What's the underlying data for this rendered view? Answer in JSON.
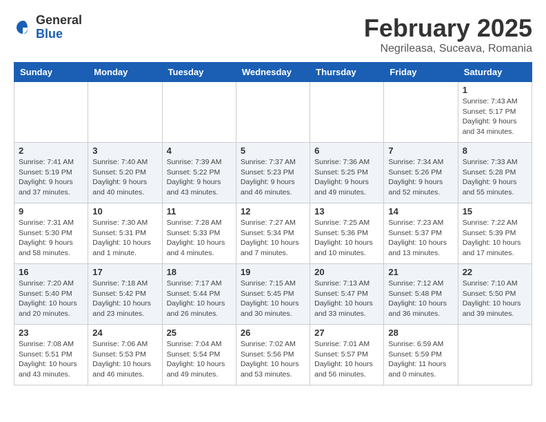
{
  "header": {
    "logo_general": "General",
    "logo_blue": "Blue",
    "month_title": "February 2025",
    "location": "Negrileasa, Suceava, Romania"
  },
  "weekdays": [
    "Sunday",
    "Monday",
    "Tuesday",
    "Wednesday",
    "Thursday",
    "Friday",
    "Saturday"
  ],
  "weeks": [
    [
      {
        "day": "",
        "info": ""
      },
      {
        "day": "",
        "info": ""
      },
      {
        "day": "",
        "info": ""
      },
      {
        "day": "",
        "info": ""
      },
      {
        "day": "",
        "info": ""
      },
      {
        "day": "",
        "info": ""
      },
      {
        "day": "1",
        "info": "Sunrise: 7:43 AM\nSunset: 5:17 PM\nDaylight: 9 hours and 34 minutes."
      }
    ],
    [
      {
        "day": "2",
        "info": "Sunrise: 7:41 AM\nSunset: 5:19 PM\nDaylight: 9 hours and 37 minutes."
      },
      {
        "day": "3",
        "info": "Sunrise: 7:40 AM\nSunset: 5:20 PM\nDaylight: 9 hours and 40 minutes."
      },
      {
        "day": "4",
        "info": "Sunrise: 7:39 AM\nSunset: 5:22 PM\nDaylight: 9 hours and 43 minutes."
      },
      {
        "day": "5",
        "info": "Sunrise: 7:37 AM\nSunset: 5:23 PM\nDaylight: 9 hours and 46 minutes."
      },
      {
        "day": "6",
        "info": "Sunrise: 7:36 AM\nSunset: 5:25 PM\nDaylight: 9 hours and 49 minutes."
      },
      {
        "day": "7",
        "info": "Sunrise: 7:34 AM\nSunset: 5:26 PM\nDaylight: 9 hours and 52 minutes."
      },
      {
        "day": "8",
        "info": "Sunrise: 7:33 AM\nSunset: 5:28 PM\nDaylight: 9 hours and 55 minutes."
      }
    ],
    [
      {
        "day": "9",
        "info": "Sunrise: 7:31 AM\nSunset: 5:30 PM\nDaylight: 9 hours and 58 minutes."
      },
      {
        "day": "10",
        "info": "Sunrise: 7:30 AM\nSunset: 5:31 PM\nDaylight: 10 hours and 1 minute."
      },
      {
        "day": "11",
        "info": "Sunrise: 7:28 AM\nSunset: 5:33 PM\nDaylight: 10 hours and 4 minutes."
      },
      {
        "day": "12",
        "info": "Sunrise: 7:27 AM\nSunset: 5:34 PM\nDaylight: 10 hours and 7 minutes."
      },
      {
        "day": "13",
        "info": "Sunrise: 7:25 AM\nSunset: 5:36 PM\nDaylight: 10 hours and 10 minutes."
      },
      {
        "day": "14",
        "info": "Sunrise: 7:23 AM\nSunset: 5:37 PM\nDaylight: 10 hours and 13 minutes."
      },
      {
        "day": "15",
        "info": "Sunrise: 7:22 AM\nSunset: 5:39 PM\nDaylight: 10 hours and 17 minutes."
      }
    ],
    [
      {
        "day": "16",
        "info": "Sunrise: 7:20 AM\nSunset: 5:40 PM\nDaylight: 10 hours and 20 minutes."
      },
      {
        "day": "17",
        "info": "Sunrise: 7:18 AM\nSunset: 5:42 PM\nDaylight: 10 hours and 23 minutes."
      },
      {
        "day": "18",
        "info": "Sunrise: 7:17 AM\nSunset: 5:44 PM\nDaylight: 10 hours and 26 minutes."
      },
      {
        "day": "19",
        "info": "Sunrise: 7:15 AM\nSunset: 5:45 PM\nDaylight: 10 hours and 30 minutes."
      },
      {
        "day": "20",
        "info": "Sunrise: 7:13 AM\nSunset: 5:47 PM\nDaylight: 10 hours and 33 minutes."
      },
      {
        "day": "21",
        "info": "Sunrise: 7:12 AM\nSunset: 5:48 PM\nDaylight: 10 hours and 36 minutes."
      },
      {
        "day": "22",
        "info": "Sunrise: 7:10 AM\nSunset: 5:50 PM\nDaylight: 10 hours and 39 minutes."
      }
    ],
    [
      {
        "day": "23",
        "info": "Sunrise: 7:08 AM\nSunset: 5:51 PM\nDaylight: 10 hours and 43 minutes."
      },
      {
        "day": "24",
        "info": "Sunrise: 7:06 AM\nSunset: 5:53 PM\nDaylight: 10 hours and 46 minutes."
      },
      {
        "day": "25",
        "info": "Sunrise: 7:04 AM\nSunset: 5:54 PM\nDaylight: 10 hours and 49 minutes."
      },
      {
        "day": "26",
        "info": "Sunrise: 7:02 AM\nSunset: 5:56 PM\nDaylight: 10 hours and 53 minutes."
      },
      {
        "day": "27",
        "info": "Sunrise: 7:01 AM\nSunset: 5:57 PM\nDaylight: 10 hours and 56 minutes."
      },
      {
        "day": "28",
        "info": "Sunrise: 6:59 AM\nSunset: 5:59 PM\nDaylight: 11 hours and 0 minutes."
      },
      {
        "day": "",
        "info": ""
      }
    ]
  ]
}
